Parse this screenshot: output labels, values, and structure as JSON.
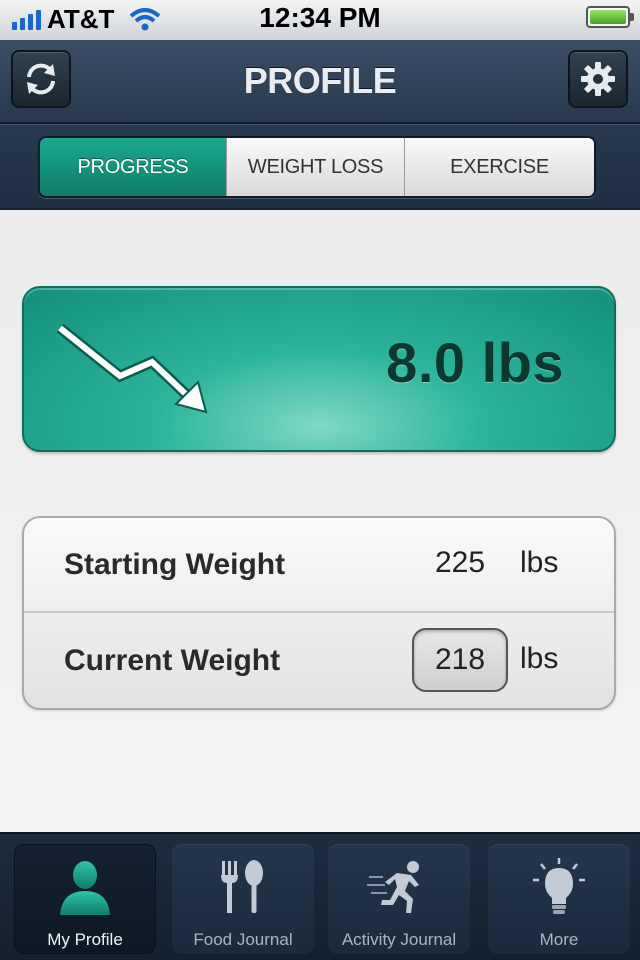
{
  "status_bar": {
    "carrier": "AT&T",
    "time": "12:34 PM",
    "icons": [
      "signal-bars-icon",
      "wifi-icon",
      "battery-icon"
    ]
  },
  "nav": {
    "title": "PROFILE",
    "left_button_icon": "refresh-icon",
    "right_button_icon": "gear-icon",
    "segments": [
      {
        "label": "PROGRESS",
        "active": true
      },
      {
        "label": "WEIGHT LOSS",
        "active": false
      },
      {
        "label": "EXERCISE",
        "active": false
      }
    ]
  },
  "progress": {
    "value": "8.0 lbs",
    "icon": "downward-trend-arrow-icon"
  },
  "weights": {
    "starting": {
      "label": "Starting Weight",
      "value": "225",
      "unit": "lbs"
    },
    "current": {
      "label": "Current Weight",
      "value": "218",
      "unit": "lbs"
    }
  },
  "tabbar": {
    "tabs": [
      {
        "label": "My Profile",
        "icon": "person-icon",
        "active": true
      },
      {
        "label": "Food Journal",
        "icon": "fork-spoon-icon",
        "active": false
      },
      {
        "label": "Activity Journal",
        "icon": "runner-icon",
        "active": false
      },
      {
        "label": "More",
        "icon": "lightbulb-icon",
        "active": false
      }
    ]
  },
  "colors": {
    "accent": "#1aa88f",
    "navbar": "#283a50",
    "tabbar": "#13202f"
  }
}
